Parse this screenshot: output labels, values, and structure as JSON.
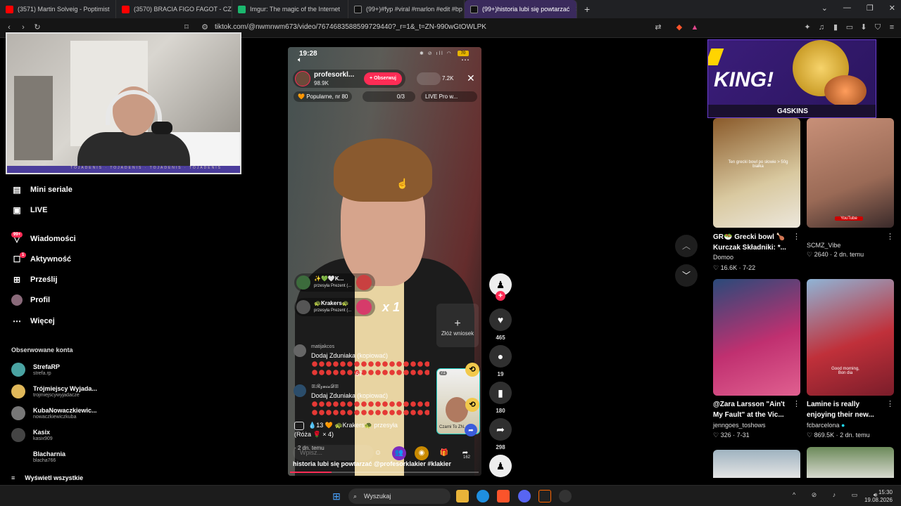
{
  "browser": {
    "tabs": [
      {
        "label": "(3571) Martin Solveig - Poptimist",
        "color": "#ff0000"
      },
      {
        "label": "(3570) BRACIA FIGO FAGOT - CZY KO",
        "color": "#ff0000"
      },
      {
        "label": "Imgur: The magic of the Internet",
        "color": "#1bb76e"
      },
      {
        "label": "(99+)#fyp #viral #marlon #edit #bp",
        "color": "#ffffff"
      },
      {
        "label": "(99+)historia lubi się powtarzać",
        "color": "#ffffff"
      }
    ],
    "new_tab": "+",
    "url": "tiktok.com/@nwmnwm673/video/7674683588599729440?_r=1&_t=ZN-990wGtOWLPK"
  },
  "sidebar": {
    "items": [
      {
        "label": "Mini seriale",
        "icon": "film-icon"
      },
      {
        "label": "LIVE",
        "icon": "tv-icon"
      },
      {
        "label": "Wiadomości",
        "icon": "messages-icon",
        "badge": "99+"
      },
      {
        "label": "Aktywność",
        "icon": "activity-icon",
        "badge": "1"
      },
      {
        "label": "Prześlij",
        "icon": "upload-icon"
      },
      {
        "label": "Profil",
        "icon": "profile-icon"
      },
      {
        "label": "Więcej",
        "icon": "more-icon"
      }
    ],
    "followed_title": "Obserwowane konta",
    "accounts": [
      {
        "name": "StrefaRP",
        "handle": "strefa.rp",
        "color": "#4aa3a2"
      },
      {
        "name": "Trójmiejscy Wyjada...",
        "handle": "trojmiejscywyjadacze",
        "color": "#e0b85a"
      },
      {
        "name": "KubaNowaczkiewic...",
        "handle": "nowaczkiewiczkuba",
        "color": "#777777"
      },
      {
        "name": "Kasix",
        "handle": "kasix909",
        "color": "#444444"
      },
      {
        "name": "Blacharnia",
        "handle": "blacha766",
        "color": "#000000"
      }
    ],
    "see_all": "Wyświetl wszystkie"
  },
  "video": {
    "phone_time": "19:28",
    "battery": "70",
    "host_name": "profesorkl...",
    "host_likes": "98.9K",
    "follow_label": "Obserwuj",
    "viewers": "7.2K",
    "rank": "Popularne, nr 80",
    "pk_score": "0/3",
    "live_pro": "LIVE Pro w...",
    "gifts": [
      {
        "name": "✨💚🤍K...",
        "sub": "przesyła Prezent (...",
        "color": "#3c6b3c",
        "icon_color": "#c94040"
      },
      {
        "name": "🐢Krakers🐢",
        "sub": "przesyła Prezent (...",
        "color": "#555555",
        "icon_color": "#d63b6a"
      }
    ],
    "combo": "x 1",
    "report_label": "Złóż wniosek",
    "comments": [
      {
        "user": "matijakcos",
        "text": "Dodaj Zduniaka (kopiować)",
        "suffix": "67",
        "color": "#666666"
      },
      {
        "user": "ꕥ𝓡𝔃𝓾𝓲𝓪𝓓ꕥ",
        "text": "Dodaj Zduniaka (kopiować)",
        "suffix": "",
        "color": "#2b4d6b"
      }
    ],
    "pip_count": "71",
    "pip_label": "Czarni To ZN...",
    "gift_event_count": "13",
    "gift_event_user": "Krakers",
    "gift_event_text": "przesyła",
    "gift_event_item": "(Róża 🌹 × 4)",
    "ago": "· 2 dn. temu",
    "input_placeholder": "Wpisz...",
    "share_count_small": "162",
    "caption": "historia lubi się powtarzać @profesorklakier #klakier",
    "progress": 0.22
  },
  "actions": {
    "likes": "465",
    "comments": "19",
    "saves": "180",
    "shares": "298"
  },
  "ad": {
    "headline": "KING!",
    "brand": "G4SKINS"
  },
  "recommended": [
    {
      "title": "GR🥗 Grecki bowl 🍗 Kurczak Składniki: *...",
      "author": "Domoo",
      "meta": "♡ 16.6K · 7-22",
      "overlay": "Ten grecki bowl po słowie > 50g białka",
      "bg": "linear-gradient(160deg,#8a5a2a,#d9c9a0 60%,#ece7dc)"
    },
    {
      "title": "",
      "author": "SCMZ_Vibe",
      "meta": "♡ 2640 · 2 dn. temu",
      "overlay": "YouTube",
      "bg": "linear-gradient(160deg,#c89078,#9a6a56 60%,#3a2a2a)"
    },
    {
      "title": "@Zara Larsson \"Ain't My Fault\" at the Vic...",
      "author": "jenngoes_toshows",
      "meta": "♡ 326 · 7-31",
      "overlay": "",
      "bg": "linear-gradient(160deg,#2a4a7a,#c03070 55%,#e06090)"
    },
    {
      "title": "Lamine is really enjoying their new...",
      "author": "fcbarcelona",
      "meta": "♡ 869.5K · 2 dn. temu",
      "overlay": "Good morning, Bon dia",
      "bg": "linear-gradient(160deg,#8fb4d6,#c0303a 55%,#7a1d2a)"
    }
  ],
  "taskbar": {
    "search": "Wyszukaj",
    "time": "15:30",
    "date": "19.08.2026"
  }
}
